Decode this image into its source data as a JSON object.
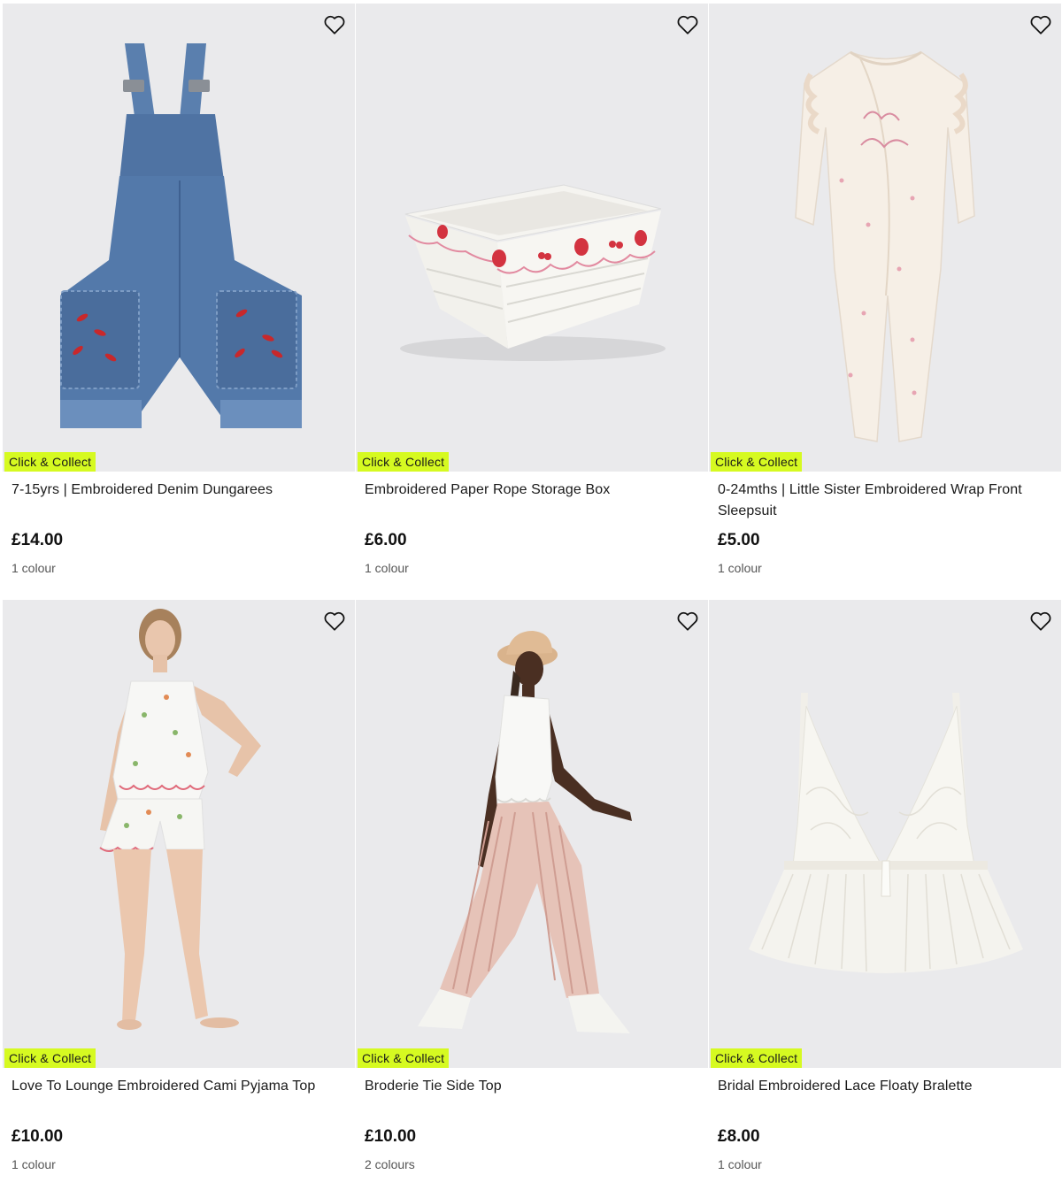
{
  "products": [
    {
      "badge": "Click & Collect",
      "title": "7-15yrs | Embroidered Denim Dungarees",
      "price": "£14.00",
      "colours": "1 colour",
      "image_icon": "denim-dungarees",
      "wishlist_icon": "heart-outline-icon"
    },
    {
      "badge": "Click & Collect",
      "title": "Embroidered Paper Rope Storage Box",
      "price": "£6.00",
      "colours": "1 colour",
      "image_icon": "storage-basket",
      "wishlist_icon": "heart-outline-icon"
    },
    {
      "badge": "Click & Collect",
      "title": "0-24mths | Little Sister Embroidered Wrap Front Sleepsuit",
      "price": "£5.00",
      "colours": "1 colour",
      "image_icon": "baby-sleepsuit",
      "wishlist_icon": "heart-outline-icon"
    },
    {
      "badge": "Click & Collect",
      "title": "Love To Lounge Embroidered Cami Pyjama Top",
      "price": "£10.00",
      "colours": "1 colour",
      "image_icon": "model-pyjamas",
      "wishlist_icon": "heart-outline-icon"
    },
    {
      "badge": "Click & Collect",
      "title": "Broderie Tie Side Top",
      "price": "£10.00",
      "colours": "2 colours",
      "image_icon": "model-broderie-top",
      "wishlist_icon": "heart-outline-icon"
    },
    {
      "badge": "Click & Collect",
      "title": "Bridal Embroidered Lace Floaty Bralette",
      "price": "£8.00",
      "colours": "1 colour",
      "image_icon": "lace-bralette",
      "wishlist_icon": "heart-outline-icon"
    }
  ],
  "colors": {
    "badge_bg": "#d6fa21",
    "image_bg": "#eaeaec",
    "text": "#1a1a1a",
    "muted": "#555555"
  }
}
